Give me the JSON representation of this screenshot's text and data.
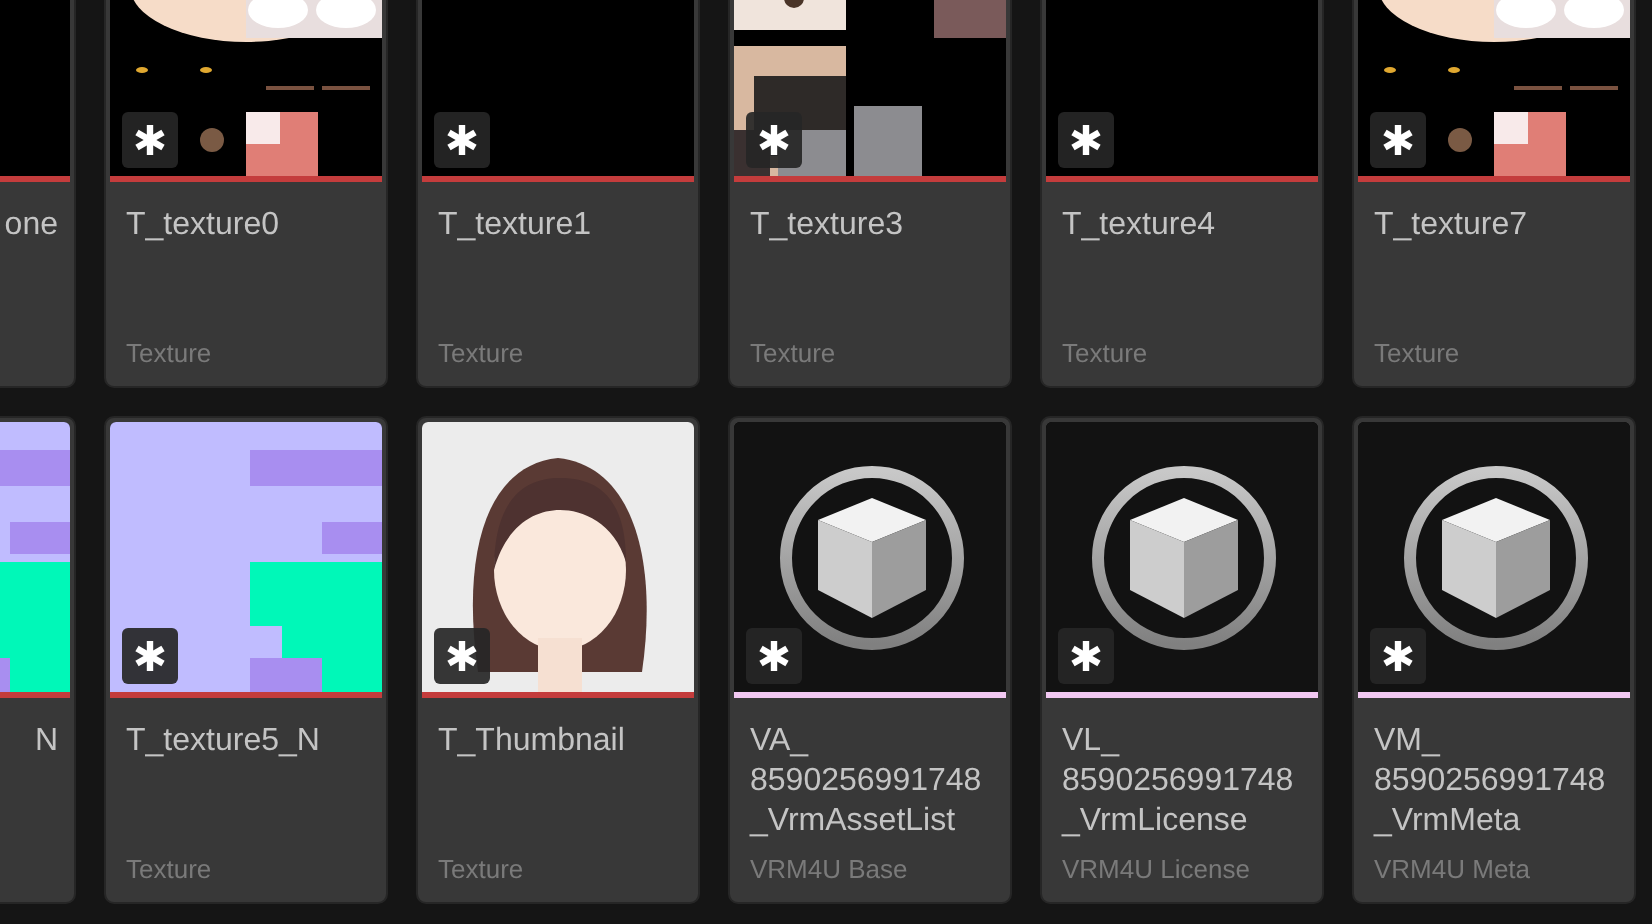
{
  "rows": [
    {
      "tiles": [
        {
          "kind": "picture",
          "name": "one",
          "color": "#c43c3c"
        },
        {
          "kind": "picture",
          "name": "T_texture0",
          "type": "Texture",
          "color": "#c43c3c"
        },
        {
          "kind": "picture",
          "name": "T_texture1",
          "type": "Texture",
          "color": "#c43c3c"
        },
        {
          "kind": "picture",
          "name": "T_texture3",
          "type": "Texture",
          "color": "#c43c3c"
        },
        {
          "kind": "picture",
          "name": "T_texture4",
          "type": "Texture",
          "color": "#c43c3c"
        },
        {
          "kind": "picture",
          "name": "T_texture7",
          "type": "Texture",
          "color": "#c43c3c"
        }
      ]
    },
    {
      "tiles": [
        {
          "kind": "picture",
          "name": "N",
          "color": "#c43c3c"
        },
        {
          "kind": "picture",
          "name": "T_texture5_N",
          "type": "Texture",
          "color": "#c43c3c"
        },
        {
          "kind": "picture",
          "name": "T_Thumbnail",
          "type": "Texture",
          "color": "#c43c3c"
        },
        {
          "kind": "asset",
          "name": "VA_\n8590256991748\n_VrmAssetList",
          "type": "VRM4U Base",
          "color": "#f2c8f2"
        },
        {
          "kind": "asset",
          "name": "VL_\n8590256991748\n_VrmLicense",
          "type": "VRM4U License",
          "color": "#f2c8f2"
        },
        {
          "kind": "asset",
          "name": "VM_\n8590256991748\n_VrmMeta",
          "type": "VRM4U Meta",
          "color": "#f2c8f2"
        }
      ]
    }
  ]
}
